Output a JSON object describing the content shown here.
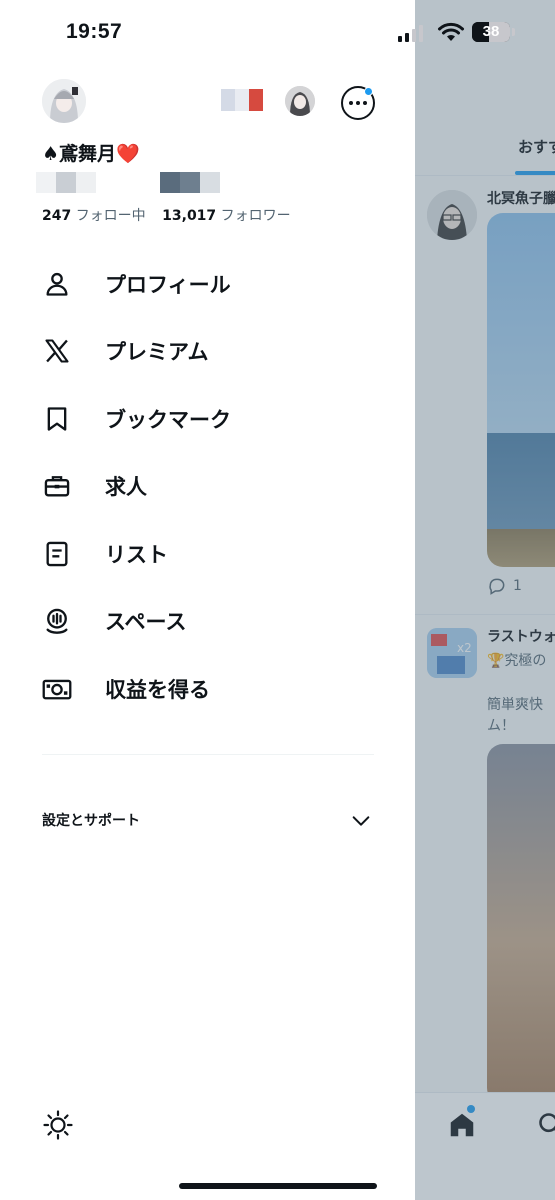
{
  "status_bar": {
    "time": "19:57",
    "battery": "38"
  },
  "profile": {
    "display_name": "♠鳶舞月❤️",
    "following_count": "247",
    "following_label": "フォロー中",
    "followers_count": "13,017",
    "followers_label": "フォロワー"
  },
  "menu": [
    {
      "label": "プロフィール",
      "icon": "person-icon"
    },
    {
      "label": "プレミアム",
      "icon": "x-logo-icon"
    },
    {
      "label": "ブックマーク",
      "icon": "bookmark-icon"
    },
    {
      "label": "求人",
      "icon": "briefcase-icon"
    },
    {
      "label": "リスト",
      "icon": "list-icon"
    },
    {
      "label": "スペース",
      "icon": "spaces-mic-icon"
    },
    {
      "label": "収益を得る",
      "icon": "money-icon"
    }
  ],
  "settings": {
    "label": "設定とサポート"
  },
  "timeline": {
    "tab_label": "おすす",
    "post1": {
      "name": "北冥魚子臘",
      "reply_count": "1"
    },
    "post2": {
      "name": "ラストウォ",
      "line1": "🏆究極の",
      "line2": "簡単爽快",
      "line3": "ム！"
    }
  },
  "colors": {
    "accent": "#1d9bf0",
    "text": "#0f1419",
    "muted": "#536471"
  }
}
